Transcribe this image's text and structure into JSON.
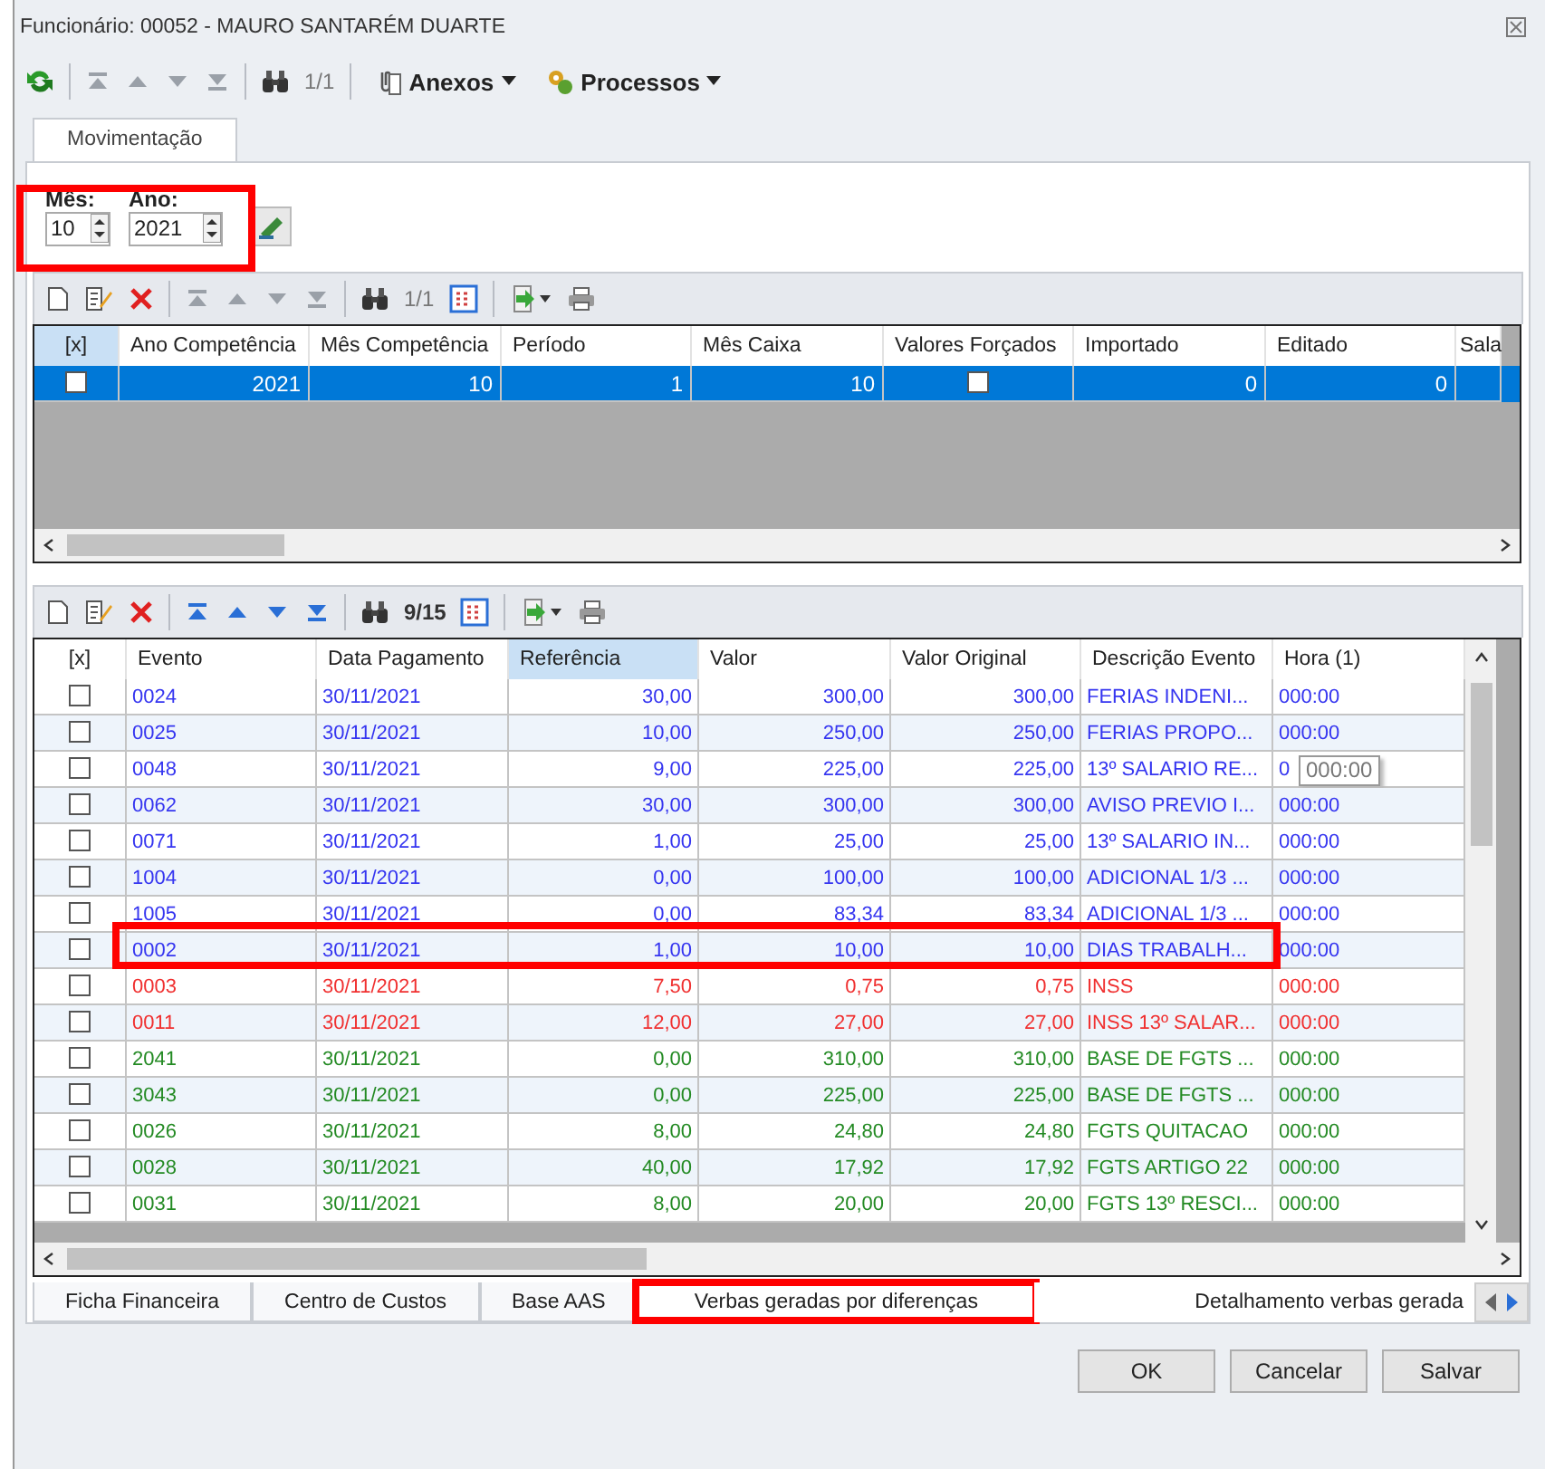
{
  "window": {
    "title": "Funcionário: 00052 - MAURO SANTARÉM DUARTE"
  },
  "toolbar": {
    "nav_enabled": false,
    "counter": "1/1",
    "menus": [
      {
        "kind": "attach",
        "label": "Anexos"
      },
      {
        "kind": "process",
        "label": "Processos"
      }
    ]
  },
  "tabs": [
    {
      "label": "Movimentação",
      "selected": true
    }
  ],
  "period": {
    "highlighted": true,
    "fields": [
      {
        "label": "Mês:",
        "value": "10"
      },
      {
        "label": "Ano:",
        "value": "2021"
      }
    ]
  },
  "grid_top": {
    "toolbar": {
      "nav_enabled": false,
      "counter": "1/1"
    },
    "columns": [
      {
        "label": "[x]",
        "selected": true
      },
      {
        "label": "Ano Competência",
        "selected": false
      },
      {
        "label": "Mês Competência",
        "selected": false
      },
      {
        "label": "Período",
        "selected": false
      },
      {
        "label": "Mês Caixa",
        "selected": false
      },
      {
        "label": "Valores Forçados",
        "selected": false
      },
      {
        "label": "Importado",
        "selected": false
      },
      {
        "label": "Editado",
        "selected": false
      },
      {
        "label": "Sala",
        "selected": false
      }
    ],
    "rows": [
      {
        "selected": true,
        "checked": false,
        "ano": "2021",
        "mes": "10",
        "periodo": "1",
        "mes_caixa": "10",
        "valores_forcados": false,
        "importado": "0",
        "editado": "0"
      }
    ]
  },
  "grid_bottom": {
    "toolbar": {
      "nav_enabled": true,
      "counter": "9/15"
    },
    "columns": [
      {
        "label": "[x]",
        "selected": false
      },
      {
        "label": "Evento",
        "selected": false
      },
      {
        "label": "Data Pagamento",
        "selected": false
      },
      {
        "label": "Referência",
        "selected": true
      },
      {
        "label": "Valor",
        "selected": false
      },
      {
        "label": "Valor Original",
        "selected": false
      },
      {
        "label": "Descrição Evento",
        "selected": false
      },
      {
        "label": "Hora (1)",
        "selected": false
      }
    ],
    "rows": [
      {
        "checked": false,
        "color": "#3535f0",
        "highlighted": false,
        "evento": "0024",
        "data": "30/11/2021",
        "referencia": "30,00",
        "valor": "300,00",
        "valor_original": "300,00",
        "descricao": "FERIAS INDENI...",
        "hora": "000:00"
      },
      {
        "checked": false,
        "color": "#3535f0",
        "highlighted": false,
        "evento": "0025",
        "data": "30/11/2021",
        "referencia": "10,00",
        "valor": "250,00",
        "valor_original": "250,00",
        "descricao": "FERIAS PROPO...",
        "hora": "000:00"
      },
      {
        "checked": false,
        "color": "#3535f0",
        "highlighted": false,
        "evento": "0048",
        "data": "30/11/2021",
        "referencia": "9,00",
        "valor": "225,00",
        "valor_original": "225,00",
        "descricao": "13º SALARIO RE...",
        "hora": "0",
        "tooltip": "000:00"
      },
      {
        "checked": false,
        "color": "#3535f0",
        "highlighted": false,
        "evento": "0062",
        "data": "30/11/2021",
        "referencia": "30,00",
        "valor": "300,00",
        "valor_original": "300,00",
        "descricao": "AVISO PREVIO I...",
        "hora": "000:00"
      },
      {
        "checked": false,
        "color": "#3535f0",
        "highlighted": false,
        "evento": "0071",
        "data": "30/11/2021",
        "referencia": "1,00",
        "valor": "25,00",
        "valor_original": "25,00",
        "descricao": "13º SALARIO IN...",
        "hora": "000:00"
      },
      {
        "checked": false,
        "color": "#3535f0",
        "highlighted": false,
        "evento": "1004",
        "data": "30/11/2021",
        "referencia": "0,00",
        "valor": "100,00",
        "valor_original": "100,00",
        "descricao": "ADICIONAL 1/3 ...",
        "hora": "000:00"
      },
      {
        "checked": false,
        "color": "#3535f0",
        "highlighted": false,
        "evento": "1005",
        "data": "30/11/2021",
        "referencia": "0,00",
        "valor": "83,34",
        "valor_original": "83,34",
        "descricao": "ADICIONAL 1/3 ...",
        "hora": "000:00"
      },
      {
        "checked": false,
        "color": "#3535f0",
        "highlighted": true,
        "evento": "0002",
        "data": "30/11/2021",
        "referencia": "1,00",
        "valor": "10,00",
        "valor_original": "10,00",
        "descricao": "DIAS TRABALH...",
        "hora": "000:00"
      },
      {
        "checked": false,
        "color": "#f03030",
        "highlighted": false,
        "evento": "0003",
        "data": "30/11/2021",
        "referencia": "7,50",
        "valor": "0,75",
        "valor_original": "0,75",
        "descricao": "INSS",
        "hora": "000:00"
      },
      {
        "checked": false,
        "color": "#f03030",
        "highlighted": false,
        "evento": "0011",
        "data": "30/11/2021",
        "referencia": "12,00",
        "valor": "27,00",
        "valor_original": "27,00",
        "descricao": "INSS 13º SALAR...",
        "hora": "000:00"
      },
      {
        "checked": false,
        "color": "#238a23",
        "highlighted": false,
        "evento": "2041",
        "data": "30/11/2021",
        "referencia": "0,00",
        "valor": "310,00",
        "valor_original": "310,00",
        "descricao": "BASE DE FGTS ...",
        "hora": "000:00"
      },
      {
        "checked": false,
        "color": "#238a23",
        "highlighted": false,
        "evento": "3043",
        "data": "30/11/2021",
        "referencia": "0,00",
        "valor": "225,00",
        "valor_original": "225,00",
        "descricao": "BASE DE FGTS ...",
        "hora": "000:00"
      },
      {
        "checked": false,
        "color": "#238a23",
        "highlighted": false,
        "evento": "0026",
        "data": "30/11/2021",
        "referencia": "8,00",
        "valor": "24,80",
        "valor_original": "24,80",
        "descricao": "FGTS QUITACAO",
        "hora": "000:00"
      },
      {
        "checked": false,
        "color": "#238a23",
        "highlighted": false,
        "evento": "0028",
        "data": "30/11/2021",
        "referencia": "40,00",
        "valor": "17,92",
        "valor_original": "17,92",
        "descricao": "FGTS ARTIGO 22",
        "hora": "000:00"
      },
      {
        "checked": false,
        "color": "#238a23",
        "highlighted": false,
        "evento": "0031",
        "data": "30/11/2021",
        "referencia": "8,00",
        "valor": "20,00",
        "valor_original": "20,00",
        "descricao": "FGTS 13º RESCI...",
        "hora": "000:00"
      }
    ]
  },
  "bottom_tabs": [
    {
      "label": "Ficha Financeira",
      "selected": false,
      "highlighted": false
    },
    {
      "label": "Centro de Custos",
      "selected": false,
      "highlighted": false
    },
    {
      "label": "Base AAS",
      "selected": false,
      "highlighted": false
    },
    {
      "label": "Verbas geradas por diferenças",
      "selected": true,
      "highlighted": true
    },
    {
      "label": "Detalhamento verbas gerada",
      "selected": false,
      "highlighted": false
    }
  ],
  "buttons": [
    {
      "label": "OK"
    },
    {
      "label": "Cancelar"
    },
    {
      "label": "Salvar"
    }
  ]
}
